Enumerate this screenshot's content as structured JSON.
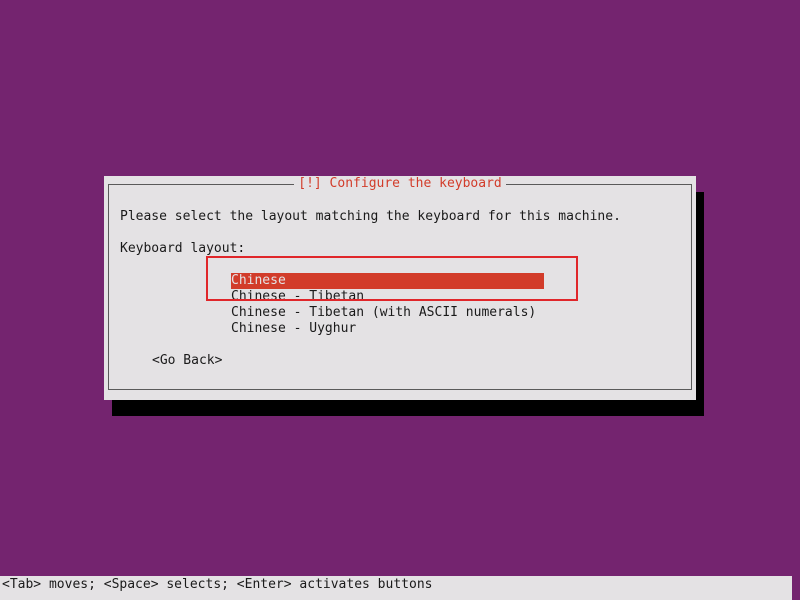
{
  "colors": {
    "background": "#74246f",
    "dialog": "#e4e2e4",
    "accent": "#d23c2a",
    "shadow": "#000000"
  },
  "dialog": {
    "title": "[!] Configure the keyboard",
    "message": "Please select the layout matching the keyboard for this machine.",
    "field_label": "Keyboard layout:",
    "options": [
      {
        "label": "Chinese",
        "selected": true
      },
      {
        "label": "Chinese - Tibetan",
        "selected": false
      },
      {
        "label": "Chinese - Tibetan (with ASCII numerals)",
        "selected": false
      },
      {
        "label": "Chinese - Uyghur",
        "selected": false
      }
    ],
    "back_button": "<Go Back>"
  },
  "statusbar": {
    "help": "<Tab> moves; <Space> selects; <Enter> activates buttons"
  }
}
